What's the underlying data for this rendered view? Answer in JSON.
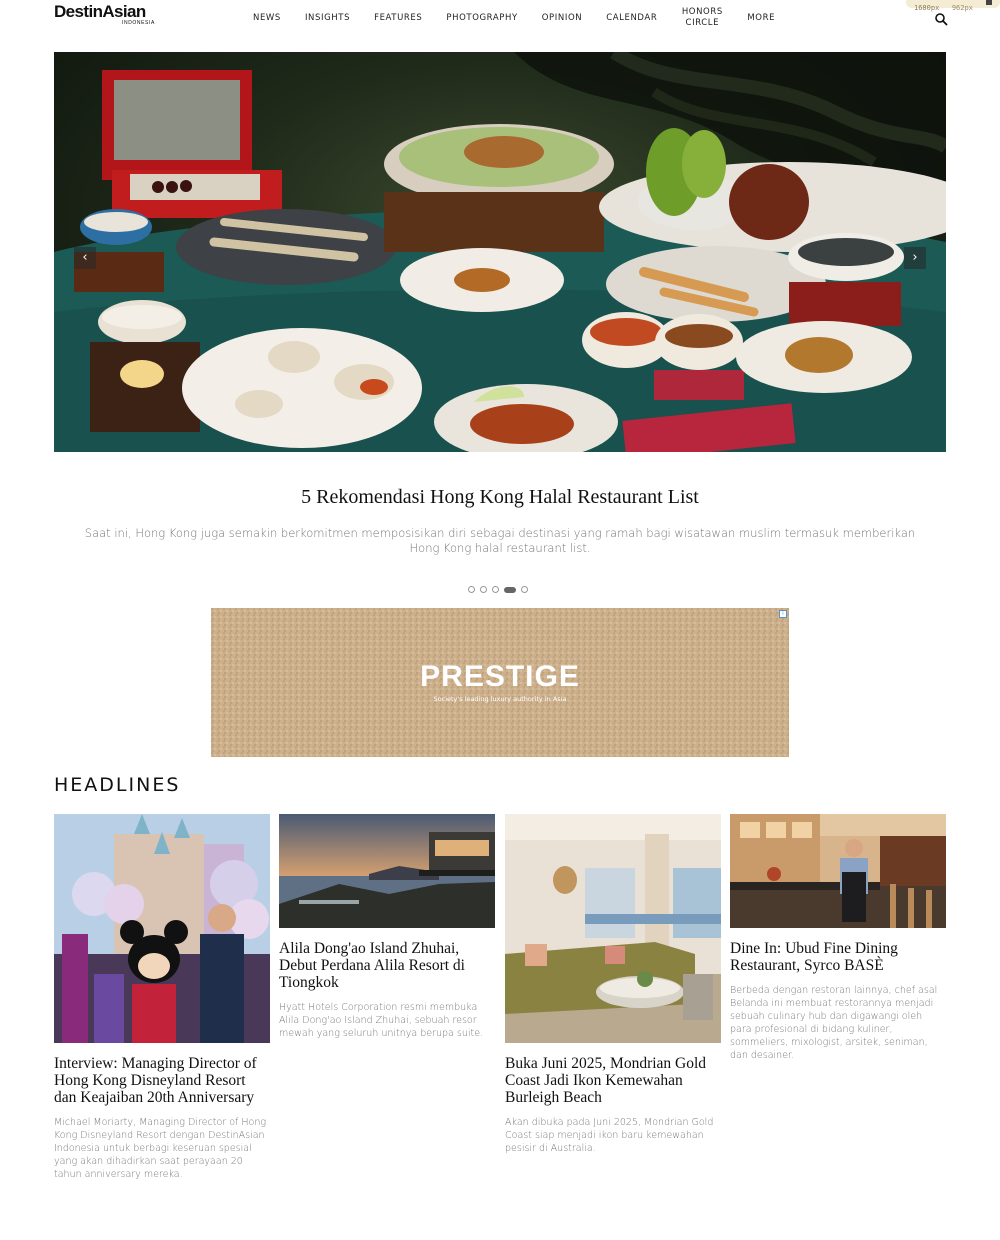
{
  "header": {
    "logo_main": "DestinAsian",
    "logo_sub": "INDONESIA",
    "nav": [
      "NEWS",
      "INSIGHTS",
      "FEATURES",
      "PHOTOGRAPHY",
      "OPINION",
      "CALENDAR",
      "HONORS CIRCLE",
      "MORE"
    ],
    "search_icon": "search-icon",
    "dev_badge": {
      "width": "w: 1680px",
      "height": "h: 962px"
    }
  },
  "hero": {
    "prev_label": "‹",
    "next_label": "›",
    "title": "5 Rekomendasi Hong Kong Halal Restaurant List",
    "description": "Saat ini, Hong Kong juga semakin berkomitmen memposisikan diri sebagai destinasi yang ramah bagi wisatawan muslim termasuk memberikan Hong Kong halal restaurant list.",
    "slide_count": 5,
    "active_slide": 4
  },
  "ad": {
    "title": "PRESTIGE",
    "subtitle": "Society's leading luxury authority in Asia"
  },
  "headlines": {
    "heading": "HEADLINES",
    "cards": [
      {
        "title": "Interview: Managing Director of Hong Kong Disneyland Resort dan Keajaiban 20th Anniversary",
        "description": "Michael Moriarty, Managing Director of Hong Kong Disneyland Resort dengan DestinAsian Indonesia untuk berbagi keseruan spesial yang akan dihadirkan saat perayaan 20 tahun anniversary mereka."
      },
      {
        "title": "Alila Dong'ao Island Zhuhai, Debut Perdana Alila Resort di Tiongkok",
        "description": "Hyatt Hotels Corporation resmi membuka Alila Dong'ao Island Zhuhai, sebuah resor mewah yang seluruh unitnya berupa suite."
      },
      {
        "title": "Buka Juni 2025, Mondrian Gold Coast Jadi Ikon Kemewahan Burleigh Beach",
        "description": "Akan dibuka pada Juni 2025, Mondrian Gold Coast siap menjadi ikon baru kemewahan pesisir di Australia."
      },
      {
        "title": "Dine In: Ubud Fine Dining Restaurant, Syrco BASÈ",
        "description": "Berbeda dengan restoran lainnya, chef asal Belanda ini membuat restorannya menjadi sebuah culinary hub dan digawangi oleh para profesional di bidang kuliner, sommeliers, mixologist, arsitek, seniman, dan desainer."
      }
    ]
  }
}
